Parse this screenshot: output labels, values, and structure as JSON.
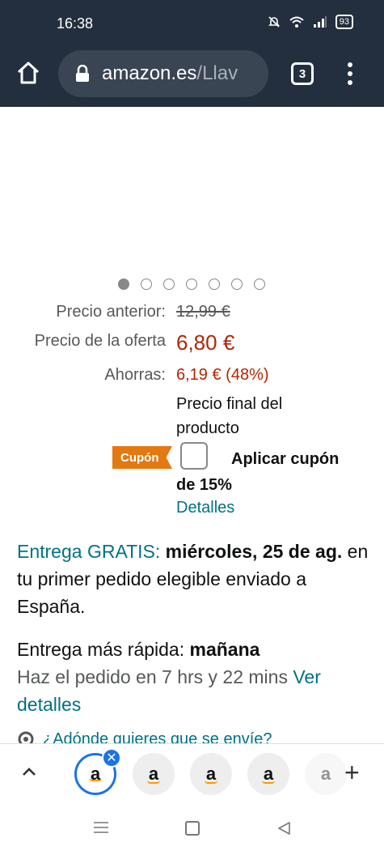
{
  "status_bar": {
    "time": "16:38",
    "battery": "93"
  },
  "browser": {
    "url_main": "amazon.es",
    "url_rest": "/Llav",
    "tab_count": "3"
  },
  "carousel": {
    "total": 7,
    "active_index": 0
  },
  "price": {
    "previous_label": "Precio anterior:",
    "previous_value": "12,99 €",
    "offer_label": "Precio de la oferta",
    "offer_value": "6,80 €",
    "savings_label": "Ahorras:",
    "savings_value": "6,19 € (48%)",
    "final_note": "Precio final del producto"
  },
  "coupon": {
    "badge": "Cupón",
    "apply_text": "Aplicar cupón de 15%",
    "details": "Detalles"
  },
  "delivery": {
    "free_label": "Entrega GRATIS:",
    "date": "miércoles, 25 de ag.",
    "rest": " en tu primer pedido elegible enviado a España."
  },
  "fast_delivery": {
    "label": "Entrega más rápida:",
    "when": "mañana",
    "order_within": "Haz el pedido en 7 hrs y 22 mins",
    "link": "Ver detalles"
  },
  "partial_text": "¿Adónde quieres que se envíe?",
  "tabs": {
    "thumb_letter": "a",
    "close": "✕",
    "new_tab": "+"
  },
  "colors": {
    "header": "#232f3e",
    "price_red": "#b12704",
    "link_teal": "#007185",
    "coupon_orange": "#e47911",
    "tab_blue": "#1a73e8"
  },
  "icons": [
    "home-icon",
    "lock-icon",
    "menu-dots-icon",
    "chevron-up-icon",
    "close-icon",
    "plus-icon",
    "nav-menu-icon",
    "nav-home-icon",
    "nav-back-icon"
  ]
}
